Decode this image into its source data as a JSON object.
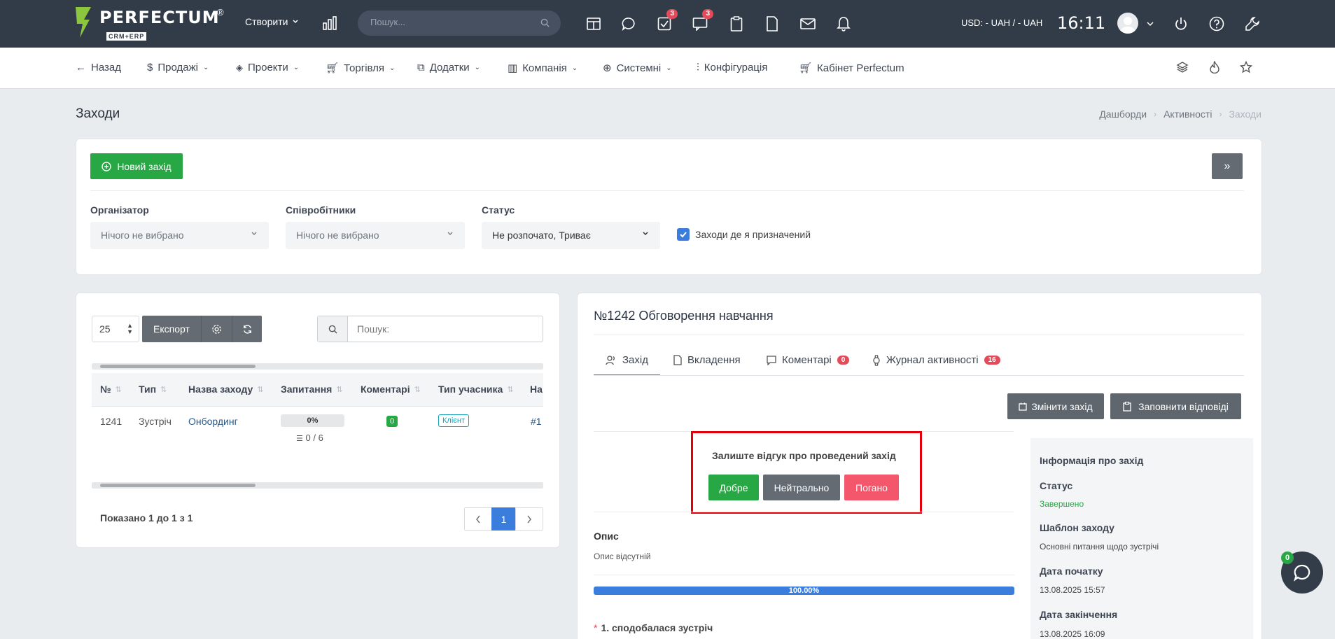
{
  "app": {
    "logo_text": "PERFECTUM",
    "logo_sub": "CRM+ERP",
    "logo_reg": "®"
  },
  "topbar": {
    "create_label": "Створити",
    "search_placeholder": "Пошук...",
    "tasks_badge": "3",
    "messages_badge": "3",
    "currency": "USD: - UAH / - UAH",
    "time": "16:11"
  },
  "nav": {
    "back": "Назад",
    "sales": "Продажі",
    "projects": "Проекти",
    "trade": "Торгівля",
    "addons": "Додатки",
    "company": "Компанія",
    "system": "Системні",
    "config": "Конфігурація",
    "cabinet": "Кабінет Perfectum"
  },
  "page": {
    "title": "Заходи",
    "breadcrumb": [
      "Дашборди",
      "Активності",
      "Заходи"
    ]
  },
  "filters": {
    "new_button": "Новий захід",
    "expand_button": "»",
    "organizer_label": "Організатор",
    "organizer_value": "Нічого не вибрано",
    "employees_label": "Співробітники",
    "employees_value": "Нічого не вибрано",
    "status_label": "Статус",
    "status_value": "Не розпочато, Триває",
    "assigned_label": "Заходи де я призначений",
    "assigned_checked": true
  },
  "table": {
    "per_page": "25",
    "export_label": "Експорт",
    "search_placeholder": "Пошук:",
    "columns": [
      "№",
      "Тип",
      "Назва заходу",
      "Запитання",
      "Коментарі",
      "Тип учасника",
      "На"
    ],
    "rows": [
      {
        "id": "1241",
        "type": "Зустріч",
        "name": "Онбординг",
        "progress": "0%",
        "questions": "0 / 6",
        "comments": "0",
        "participant_type": "Клієнт",
        "extra": "#1"
      }
    ],
    "summary": "Показано 1 до 1 з 1",
    "page": "1"
  },
  "detail": {
    "title": "№1242 Обговорення навчання",
    "tabs": [
      {
        "label": "Захід",
        "badge": ""
      },
      {
        "label": "Вкладення",
        "badge": ""
      },
      {
        "label": "Коментарі",
        "badge": "0"
      },
      {
        "label": "Журнал активності",
        "badge": "16"
      }
    ],
    "edit_button": "Змінити захід",
    "answers_button": "Заповнити відповіді",
    "feedback_title": "Залиште відгук про проведений захід",
    "feedback_good": "Добре",
    "feedback_neutral": "Нейтрально",
    "feedback_bad": "Погано",
    "description_label": "Опис",
    "description_value": "Опис відсутній",
    "progress_label": "100.00%",
    "progress_value": 1.0,
    "question_1": "1. сподобалася зустріч",
    "question_required_mark": "*"
  },
  "info": {
    "title": "Інформація про захід",
    "status_label": "Статус",
    "status_value": "Завершено",
    "template_label": "Шаблон заходу",
    "template_value": "Основні питання щодо зустрічі",
    "start_label": "Дата початку",
    "start_value": "13.08.2025 15:57",
    "end_label": "Дата закінчення",
    "end_value": "13.08.2025 16:09"
  },
  "chat": {
    "badge": "0"
  },
  "colors": {
    "topbar": "#323c49",
    "green": "#28a745",
    "red": "#e34a5a",
    "blue": "#3b7ddd",
    "highlight_border": "#e4000a"
  }
}
